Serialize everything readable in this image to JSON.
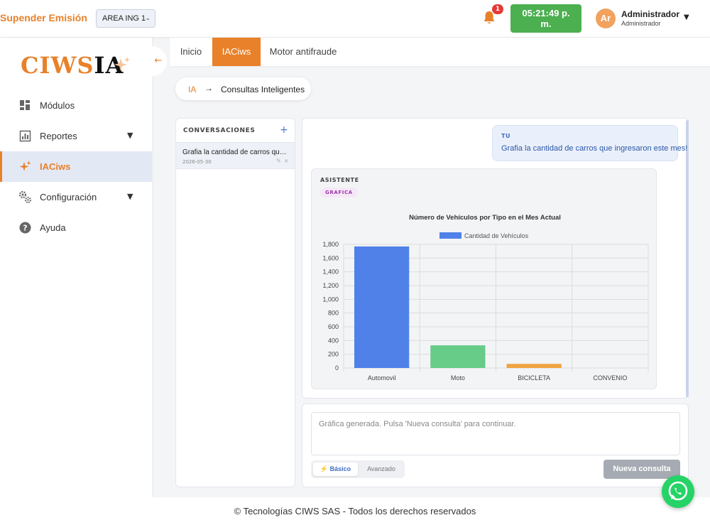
{
  "header": {
    "suspend_label": "Supender Emisión",
    "area_select_value": "AREA ING 1",
    "notification_count": "1",
    "clock_line1": "05:21:49 p.",
    "clock_line2": "m.",
    "avatar_initials": "Ar",
    "user_name": "Administrador",
    "user_role": "Administrador"
  },
  "sidebar": {
    "logo_primary": "CIWS",
    "logo_secondary": "IA",
    "items": [
      {
        "label": "Módulos",
        "icon": "dashboard-icon"
      },
      {
        "label": "Reportes",
        "icon": "bar-report-icon"
      },
      {
        "label": "IACiws",
        "icon": "sparkle-icon"
      },
      {
        "label": "Configuración",
        "icon": "gears-icon"
      },
      {
        "label": "Ayuda",
        "icon": "help-icon"
      }
    ]
  },
  "tabs": [
    {
      "label": "Inicio"
    },
    {
      "label": "IACiws"
    },
    {
      "label": "Motor antifraude"
    }
  ],
  "breadcrumb": {
    "root": "IA",
    "separator": "→",
    "current": "Consultas Inteligentes"
  },
  "conversations": {
    "heading": "CONVERSACIONES",
    "add_symbol": "+",
    "items": [
      {
        "title": "Grafia la cantidad de carros que ingresaron este mes!",
        "date": "2026-05-30"
      }
    ]
  },
  "chat": {
    "user_tag": "TU",
    "user_message": "Grafia la cantidad de carros que ingresaron este mes!",
    "assistant_tag": "ASISTENTE",
    "assistant_badge": "GRAFICA"
  },
  "chart_data": {
    "type": "bar",
    "title": "Número de Vehículos por Tipo en el Mes Actual",
    "categories": [
      "Automovil",
      "Moto",
      "BICICLETA",
      "CONVENIO"
    ],
    "series": [
      {
        "name": "Cantidad de Vehículos",
        "values": [
          1770,
          330,
          60,
          0
        ],
        "colors": [
          "#4f81e8",
          "#66cc88",
          "#f0a443",
          "#cccccc"
        ]
      }
    ],
    "xlabel": "",
    "ylabel": "",
    "ylim": [
      0,
      1800
    ],
    "yticks": [
      "0",
      "200",
      "400",
      "600",
      "800",
      "1,000",
      "1,200",
      "1,400",
      "1,600",
      "1,800"
    ],
    "legend_color": "#4f81e8",
    "grid": true,
    "legend_position": "top"
  },
  "input": {
    "placeholder": "Gráfica generada. Pulsa 'Nueva consulta' para continuar.",
    "mode_basic": "⚡ Básico",
    "mode_advanced": "Avanzado",
    "new_query_label": "Nueva consulta"
  },
  "footer": {
    "text": "© Tecnologías CIWS SAS - Todos los derechos reservados"
  },
  "colors": {
    "accent": "#e8812a",
    "clock_bg": "#4caf50",
    "badge": "#e53935",
    "whatsapp": "#25d366"
  }
}
